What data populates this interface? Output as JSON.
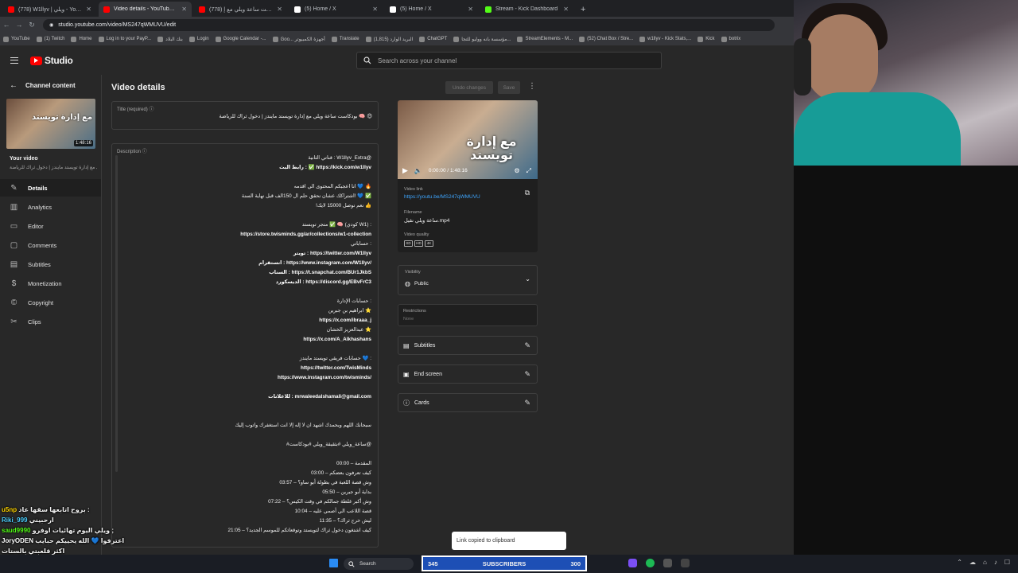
{
  "browser": {
    "tabs": [
      {
        "title": "(778) W1llyv | ويلي - YouTube",
        "color": "#ff0000",
        "active": false
      },
      {
        "title": "Video details - YouTube Studio",
        "color": "#ff0000",
        "active": true
      },
      {
        "title": "(778) بودكاست ساعة ويلي مع إ...",
        "color": "#ff0000",
        "active": false
      },
      {
        "title": "(5) Home / X",
        "color": "#ffffff",
        "active": false
      },
      {
        "title": "(5) Home / X",
        "color": "#ffffff",
        "active": false
      },
      {
        "title": "Stream - Kick Dashboard",
        "color": "#53fc18",
        "active": false
      }
    ],
    "url": "studio.youtube.com/video/MS247qWMUVU/edit",
    "bookmarks": [
      "YouTube",
      "(1) Twitch",
      "Home",
      "Log in to your PayP...",
      "بنك البلاد",
      "Login",
      "Google Calendar -...",
      "Goo... أجهزة الكمبيوتر",
      "Translate",
      "البريد الوارد (1,815)",
      "ChatGPT",
      "مؤسسة بانه ووليو للتجا...",
      "StreamElements - M...",
      "(52) Chat Box / Stre...",
      "w1llyv - Kick Stats,...",
      "Kick",
      "botrix"
    ]
  },
  "studio": {
    "logo": "Studio",
    "search_placeholder": "Search across your channel"
  },
  "sidebar": {
    "back_label": "Channel content",
    "thumb_text": "مع إدارة تويستد",
    "thumb_duration": "1:48:16",
    "your_video": "Your video",
    "video_subtitle": "بودكاست ساعة ويلي مع إدارة تويستد مايندز | دخول ثراك للرياضة",
    "items": [
      {
        "label": "Details",
        "icon": "pencil-icon"
      },
      {
        "label": "Analytics",
        "icon": "analytics-icon"
      },
      {
        "label": "Editor",
        "icon": "editor-icon"
      },
      {
        "label": "Comments",
        "icon": "comments-icon"
      },
      {
        "label": "Subtitles",
        "icon": "subtitles-icon"
      },
      {
        "label": "Monetization",
        "icon": "dollar-icon"
      },
      {
        "label": "Copyright",
        "icon": "copyright-icon"
      },
      {
        "label": "Clips",
        "icon": "scissors-icon"
      }
    ]
  },
  "main": {
    "page_title": "Video details",
    "undo_label": "Undo changes",
    "save_label": "Save",
    "title_label": "Title (required)",
    "title_value": "بودكاست ساعة ويلي مع إدارة تويستد مايندز | دخول ثراك للرياضة 🧠 😍",
    "description_label": "Description",
    "description_lines": [
      {
        "t": "قناتي الثانية : W1llyv_Extra@",
        "url": false
      },
      {
        "t": "رابط البث : ✅ https://kick.com/w1llyv",
        "url": true
      },
      {
        "t": "",
        "url": false
      },
      {
        "t": "انا اعجبكم المحتوى الي اقدمه 💙 🔥",
        "url": false
      },
      {
        "t": "اشتراكك عشان نحقق حلم ال 150الف قبل نهاية السنة! 💙 ✅",
        "url": false
      },
      {
        "t": "!نعم نوصل 15000 لايك 👍",
        "url": false
      },
      {
        "t": "",
        "url": false
      },
      {
        "t": "متجر تويستد ✅ 🧠 (كودي W1) :",
        "url": false
      },
      {
        "t": "https://store.twisminds.gg/ar/collections/w1-collection",
        "url": true
      },
      {
        "t": "حساباتي :",
        "url": false
      },
      {
        "t": "تويتر : https://twitter.com/W1llyv",
        "url": true
      },
      {
        "t": "انستقرام : https://www.instagram.com/W1llyv/",
        "url": true
      },
      {
        "t": "السناب : https://t.snapchat.com/BUr1JkbS",
        "url": true
      },
      {
        "t": "الديسكورد : https://discord.gg/EBvFrC3",
        "url": true
      },
      {
        "t": "",
        "url": false
      },
      {
        "t": "حسابات الإدارة :",
        "url": false
      },
      {
        "t": "ابراهيم بن جبرين ⭐",
        "url": false
      },
      {
        "t": "https://x.com/ibraaa_j",
        "url": true
      },
      {
        "t": "عبدالعزيز الخشان ⭐",
        "url": false
      },
      {
        "t": "https://x.com/A_Alkhashans",
        "url": true
      },
      {
        "t": "",
        "url": false
      },
      {
        "t": "حسابات فريقي تويستد مايندز 💙 :",
        "url": false
      },
      {
        "t": "https://twitter.com/TwisMinds",
        "url": true
      },
      {
        "t": "https://www.instagram.com/twisminds/",
        "url": true
      },
      {
        "t": "",
        "url": false
      },
      {
        "t": "للاعلانات : mrwaleedalshamali@gmail.com",
        "url": true
      },
      {
        "t": "",
        "url": false
      },
      {
        "t": "",
        "url": false
      },
      {
        "t": "سبحانك اللهم وبحمدك اشهد ان لا إله إلا انت استغفرك واتوب إليك",
        "url": false
      },
      {
        "t": "",
        "url": false
      },
      {
        "t": "#ساعة_ويلي #بثقيقة_ويلي #بودكاست@",
        "url": false
      },
      {
        "t": "",
        "url": false
      },
      {
        "t": "00:00 – المقدمة",
        "url": false
      },
      {
        "t": "03:00 – كيف تعرفون بعضكم",
        "url": false
      },
      {
        "t": "03:57 – وش قصة اللعبة في بطولة أبو ساو؟",
        "url": false
      },
      {
        "t": "05:50 – بداية أبو جبرين",
        "url": false
      },
      {
        "t": "07:22 – وش أكبر غلطة جمالكم في وقت الكيس؟",
        "url": false
      },
      {
        "t": "10:04 – قصة اللاعب الي أصمي عليه",
        "url": false
      },
      {
        "t": "11:35 – ليش خرج ثراك؟",
        "url": false
      },
      {
        "t": "21:05 – كيف اشتغون دخول ثراك لتويستد وتوقعاتكم للموسم الجديد؟",
        "url": false
      }
    ]
  },
  "preview": {
    "video_overlay": "مع إدارة تويستد",
    "time": "0:00:00 / 1:48:16",
    "video_link_label": "Video link",
    "video_link": "https://youtu.be/MS247qWMUVU",
    "filename_label": "Filename",
    "filename": "ساعة ويلي نقيل.mp4",
    "quality_label": "Video quality",
    "qualities": [
      "SD",
      "HD",
      "4K"
    ],
    "visibility_label": "Visibility",
    "visibility_value": "Public",
    "restrictions_label": "Restrictions",
    "restrictions_value": "None",
    "options": [
      "Subtitles",
      "End screen",
      "Cards"
    ]
  },
  "overlay": {
    "toast": "Link copied to clipboard",
    "subs_left": "345",
    "subs_label": "SUBSCRIBERS",
    "subs_right": "300",
    "taskbar_search": "Search",
    "chat": [
      {
        "user": "u5np",
        "msg": "بروح اتابعها سقها عاد :",
        "color": "#ffd400"
      },
      {
        "user": "Riki_999",
        "msg": "ارحبيني",
        "color": "#4dd0ff"
      },
      {
        "user": "saud9990",
        "msg": "ويلي اليوم تهائيات اوفرو ;",
        "color": "#53fc18"
      },
      {
        "user": "JoryODEN",
        "msg": "اعترفوا 💙 الله يحييكم حبايب",
        "color": "#ffffff"
      },
      {
        "user": "",
        "msg": "اكثر قلعبتي بالستات",
        "color": "#ffffff"
      }
    ]
  }
}
